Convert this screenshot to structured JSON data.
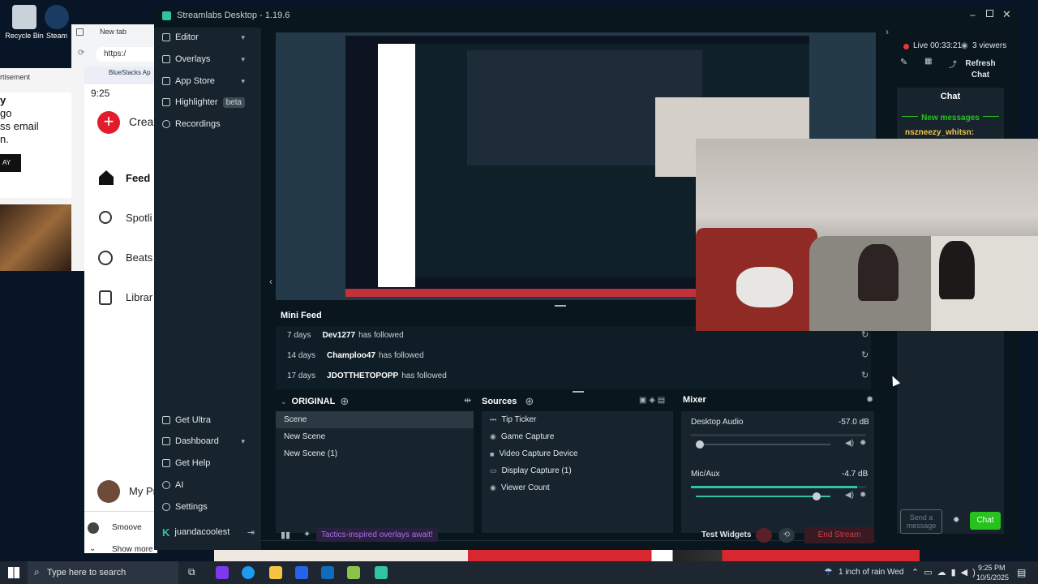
{
  "desktop": {
    "icons": [
      {
        "label": "Recycle Bin"
      },
      {
        "label": "Steam"
      }
    ],
    "browser_tab": "New tab",
    "browser_url": "https:/",
    "ad_label": "rtisement",
    "ad_lines": [
      "y",
      "go",
      "ss email",
      "n."
    ],
    "ad_button": "AY",
    "bluestacks_title": "BlueStacks Ap",
    "phone_time": "9:25",
    "create_label": "Creat",
    "feed_label": "Feed",
    "spotlight_label": "Spotli",
    "beats_label": "Beats",
    "library_label": "Librar",
    "profile_label": "My Pr",
    "smoove": "Smoove",
    "show_more": "Show more"
  },
  "app": {
    "title": "Streamlabs Desktop - 1.19.6",
    "nav": [
      {
        "label": "Editor",
        "chevron": true
      },
      {
        "label": "Overlays",
        "chevron": true
      },
      {
        "label": "App Store",
        "chevron": true
      },
      {
        "label": "Highlighter",
        "badge": "beta"
      },
      {
        "label": "Recordings"
      }
    ],
    "nav_bottom": [
      {
        "label": "Get Ultra"
      },
      {
        "label": "Dashboard",
        "chevron": true
      },
      {
        "label": "Get Help"
      },
      {
        "label": "AI"
      },
      {
        "label": "Settings"
      },
      {
        "label": "juandacoolest"
      }
    ],
    "mini_feed": {
      "title": "Mini Feed",
      "rows": [
        {
          "time": "7 days",
          "user": "Dev1277",
          "action": "has followed"
        },
        {
          "time": "14 days",
          "user": "Champloo47",
          "action": "has followed"
        },
        {
          "time": "17 days",
          "user": "JDOTTHETOPOPP",
          "action": "has followed"
        }
      ]
    },
    "scenes": {
      "title": "ORIGINAL",
      "items": [
        "Scene",
        "New Scene",
        "New Scene (1)"
      ]
    },
    "sources": {
      "title": "Sources",
      "items": [
        "Tip Ticker",
        "Game Capture",
        "Video Capture Device",
        "Display Capture (1)",
        "Viewer Count"
      ]
    },
    "mixer": {
      "title": "Mixer",
      "channels": [
        {
          "name": "Desktop Audio",
          "db": "-57.0 dB",
          "level": 0.05
        },
        {
          "name": "Mic/Aux",
          "db": "-4.7 dB",
          "level": 0.95
        }
      ]
    },
    "footer": {
      "promo": "Tactics-inspired overlays await!",
      "test_widgets": "Test Widgets",
      "end_stream": "End Stream"
    },
    "live": {
      "status": "Live 00:33:21",
      "viewers": "3 viewers",
      "refresh_chat": "Refresh Chat"
    },
    "chat": {
      "title": "Chat",
      "new_messages": "New messages",
      "user": "nszneezy_whitsn:",
      "input_placeholder": "Send a message",
      "send_button": "Chat"
    }
  },
  "taskbar": {
    "search_placeholder": "Type here to search",
    "weather": "1 inch of rain Wed",
    "time": "9:25 PM",
    "date": "10/5/2025"
  },
  "colors": {
    "accent": "#31c3a2",
    "end_stream": "#d63a45",
    "chat_green": "#27c21d",
    "promo_purple": "#a66fe8"
  }
}
